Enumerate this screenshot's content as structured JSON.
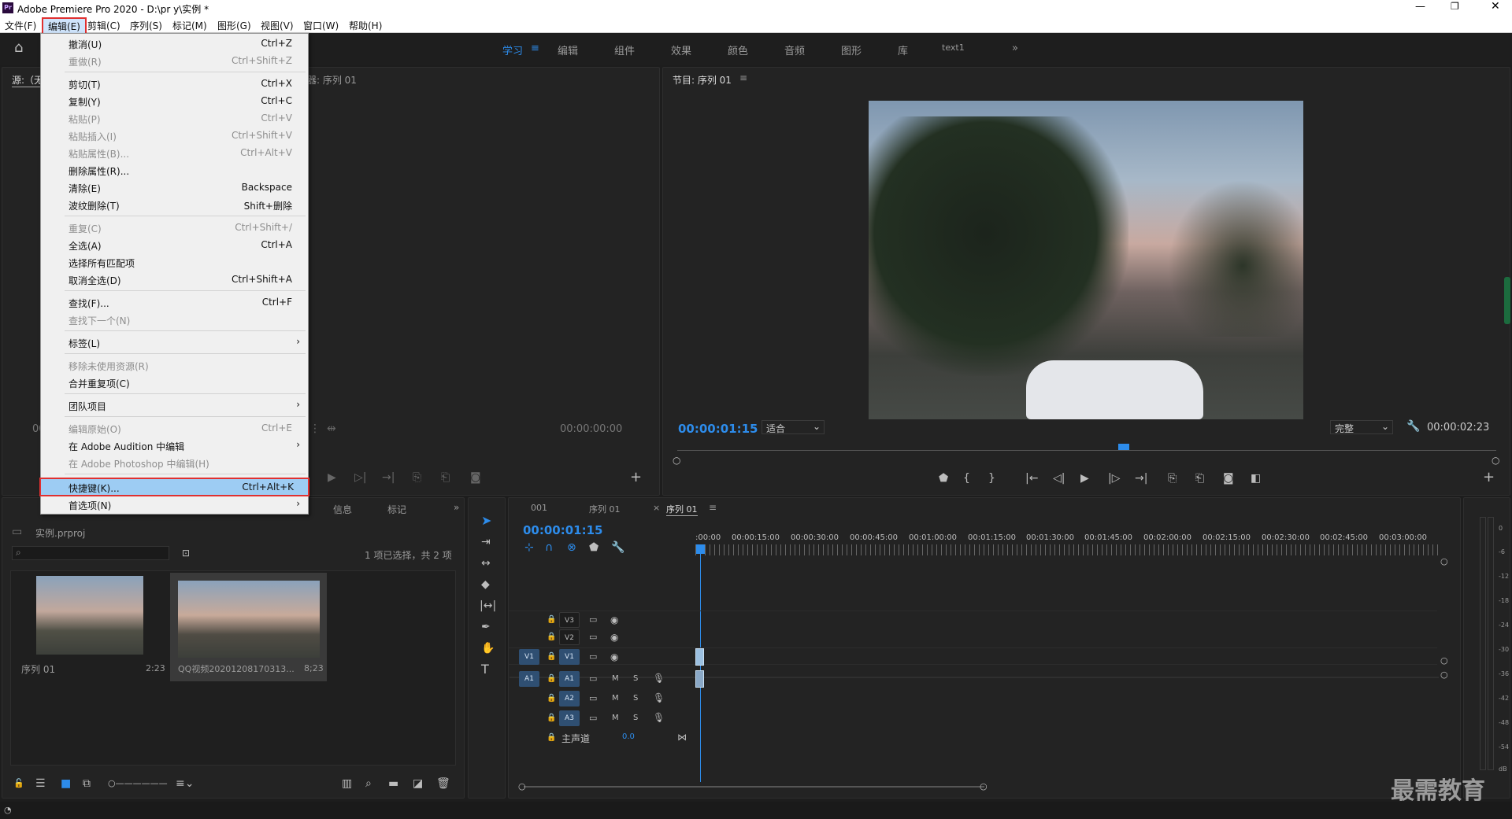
{
  "window": {
    "title": "Adobe Premiere Pro 2020 - D:\\pr y\\实例 *"
  },
  "menubar": [
    "文件(F)",
    "编辑(E)",
    "剪辑(C)",
    "序列(S)",
    "标记(M)",
    "图形(G)",
    "视图(V)",
    "窗口(W)",
    "帮助(H)"
  ],
  "workspaces": [
    "学习",
    "编辑",
    "组件",
    "效果",
    "颜色",
    "音频",
    "图形",
    "库",
    "text1"
  ],
  "edit_menu": [
    {
      "label": "撤消(U)",
      "shortcut": "Ctrl+Z",
      "enabled": true
    },
    {
      "label": "重做(R)",
      "shortcut": "Ctrl+Shift+Z",
      "enabled": false
    },
    {
      "label": "剪切(T)",
      "shortcut": "Ctrl+X",
      "enabled": true
    },
    {
      "label": "复制(Y)",
      "shortcut": "Ctrl+C",
      "enabled": true
    },
    {
      "label": "粘贴(P)",
      "shortcut": "Ctrl+V",
      "enabled": false
    },
    {
      "label": "粘贴插入(I)",
      "shortcut": "Ctrl+Shift+V",
      "enabled": false
    },
    {
      "label": "粘贴属性(B)...",
      "shortcut": "Ctrl+Alt+V",
      "enabled": false
    },
    {
      "label": "删除属性(R)...",
      "shortcut": "",
      "enabled": true
    },
    {
      "label": "清除(E)",
      "shortcut": "Backspace",
      "enabled": true
    },
    {
      "label": "波纹删除(T)",
      "shortcut": "Shift+删除",
      "enabled": true
    },
    {
      "label": "重复(C)",
      "shortcut": "Ctrl+Shift+/",
      "enabled": false
    },
    {
      "label": "全选(A)",
      "shortcut": "Ctrl+A",
      "enabled": true
    },
    {
      "label": "选择所有匹配项",
      "shortcut": "",
      "enabled": true
    },
    {
      "label": "取消全选(D)",
      "shortcut": "Ctrl+Shift+A",
      "enabled": true
    },
    {
      "label": "查找(F)...",
      "shortcut": "Ctrl+F",
      "enabled": true
    },
    {
      "label": "查找下一个(N)",
      "shortcut": "",
      "enabled": false
    },
    {
      "label": "标签(L)",
      "shortcut": "",
      "enabled": true,
      "submenu": true
    },
    {
      "label": "移除未使用资源(R)",
      "shortcut": "",
      "enabled": false
    },
    {
      "label": "合并重复项(C)",
      "shortcut": "",
      "enabled": true
    },
    {
      "label": "团队项目",
      "shortcut": "",
      "enabled": true,
      "submenu": true
    },
    {
      "label": "编辑原始(O)",
      "shortcut": "Ctrl+E",
      "enabled": false
    },
    {
      "label": "在 Adobe Audition 中编辑",
      "shortcut": "",
      "enabled": true,
      "submenu": true
    },
    {
      "label": "在 Adobe Photoshop 中编辑(H)",
      "shortcut": "",
      "enabled": false
    },
    {
      "label": "快捷键(K)...",
      "shortcut": "Ctrl+Alt+K",
      "enabled": true,
      "highlighted": true
    },
    {
      "label": "首选项(N)",
      "shortcut": "",
      "enabled": true,
      "submenu": true
    }
  ],
  "source": {
    "tab": "源:（无",
    "tab2": "器: 序列 01",
    "timecode": "00:00:00:00",
    "left_tc": "00"
  },
  "program": {
    "title": "节目: 序列 01",
    "timecode": "00:00:01:15",
    "fit": "适合",
    "quality": "完整",
    "duration": "00:00:02:23"
  },
  "project": {
    "tabs": [
      "信息",
      "标记"
    ],
    "name": "实例.prproj",
    "selection": "1 项已选择，共 2 项",
    "items": [
      {
        "name": "序列 01",
        "duration": "2:23"
      },
      {
        "name": "QQ视频20201208170313...",
        "duration": "8;23"
      }
    ]
  },
  "timeline": {
    "tabs": [
      "001",
      "序列 01",
      "序列 01"
    ],
    "timecode": "00:00:01:15",
    "ruler": [
      ":00:00",
      "00:00:15:00",
      "00:00:30:00",
      "00:00:45:00",
      "00:01:00:00",
      "00:01:15:00",
      "00:01:30:00",
      "00:01:45:00",
      "00:02:00:00",
      "00:02:15:00",
      "00:02:30:00",
      "00:02:45:00",
      "00:03:00:00"
    ],
    "video_tracks": [
      "V3",
      "V2",
      "V1"
    ],
    "audio_tracks": [
      "A1",
      "A2",
      "A3"
    ],
    "src_v": "V1",
    "src_a": "A1",
    "master": "主声道",
    "master_vol": "0.0",
    "mute": "M",
    "solo": "S"
  },
  "meter": [
    "0",
    "-6",
    "-12",
    "-18",
    "-24",
    "-30",
    "-36",
    "-42",
    "-48",
    "-54",
    "dB"
  ],
  "watermark": "最需教育"
}
